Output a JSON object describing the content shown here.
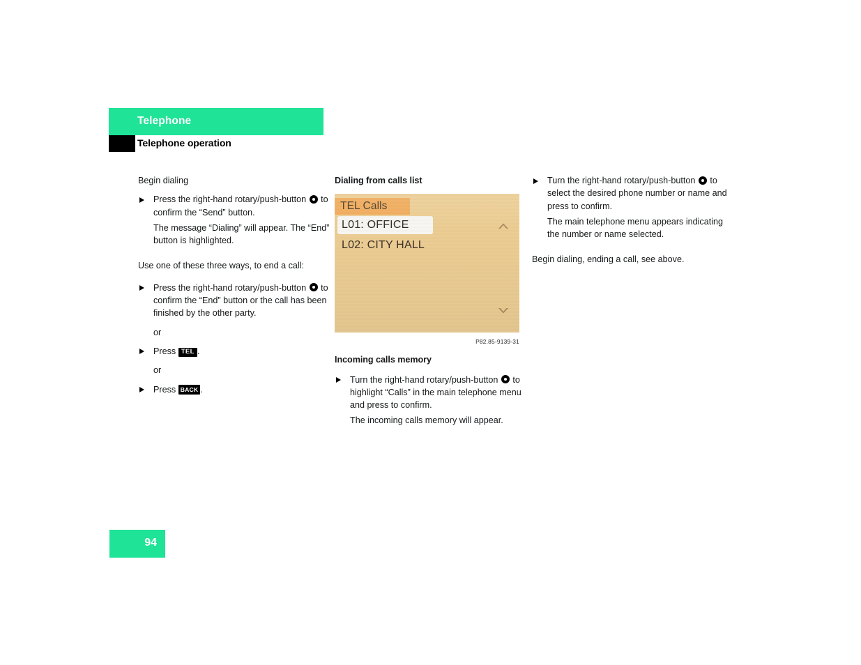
{
  "header": {
    "chapter_title": "Telephone",
    "section_title": "Telephone operation",
    "band_color": "#1fe396",
    "square_color": "#000000"
  },
  "page_number": "94",
  "columns": {
    "left": {
      "lead": "Begin dialing",
      "bullet_1": {
        "text_before": "Press the right-hand rotary/push-button ",
        "icon": "rotary-push-button-icon",
        "text_after": " to confirm the “Send” button."
      },
      "note_1": "The message “Dialing” will appear. The “End” button is highlighted.",
      "lead_2": "Use one of these three ways, to end a call:",
      "bullet_2": {
        "text_before": "Press the right-hand rotary/push-button ",
        "icon": "rotary-push-button-icon",
        "text_after": " to confirm the “End” button or the call has been finished by the other party."
      },
      "or_1": "or",
      "bullet_3": {
        "text_before": "Press ",
        "key": "TEL",
        "text_after": "."
      },
      "or_2": "or",
      "bullet_4": {
        "text_before": "Press ",
        "key": "BACK",
        "text_after": "."
      }
    },
    "middle": {
      "sub_head": "Dialing from calls list",
      "lcd": {
        "title": "TEL Calls",
        "title_bg": "#f0ab5b",
        "screen_bg": "#eccd93",
        "rows": [
          {
            "label": "L01: OFFICE",
            "highlighted": true
          },
          {
            "label": "L02: CITY HALL",
            "highlighted": false
          }
        ],
        "scroll_up_icon": "scroll-up-arrow-icon",
        "scroll_down_icon": "scroll-down-arrow-icon"
      },
      "figure_credit": "P82.85-9139-31",
      "sub_head_2": "Incoming calls memory",
      "bullet_1": {
        "text_before": "Turn the right-hand rotary/push-button ",
        "icon": "rotary-push-button-icon",
        "text_after": " to highlight “Calls” in the main telephone menu and press to confirm."
      },
      "note_1": "The incoming calls memory will appear."
    },
    "right": {
      "bullet_1": {
        "text_before": "Turn the right-hand rotary/push-button ",
        "icon": "rotary-push-button-icon",
        "text_after": " to select the desired phone number or name and press to confirm."
      },
      "note_1": "The main telephone menu appears indicating the number or name selected.",
      "note_2": "Begin dialing, ending a call, see above."
    }
  }
}
